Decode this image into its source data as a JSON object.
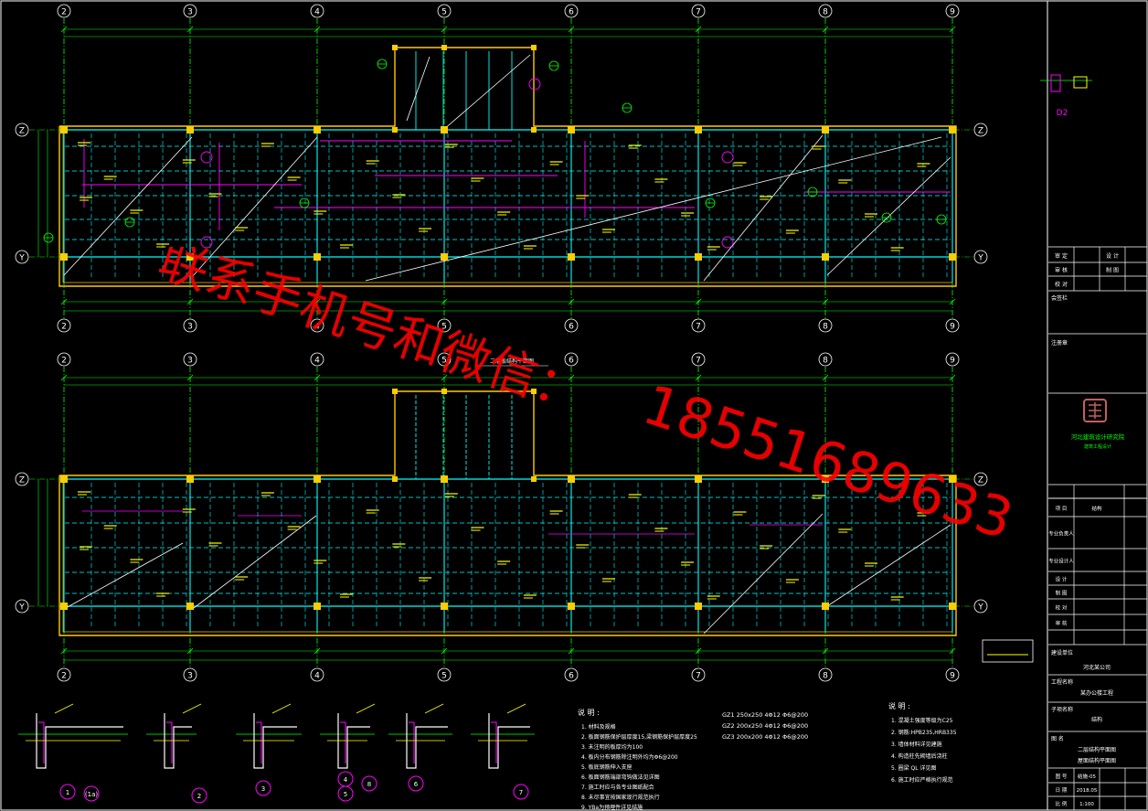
{
  "drawing": {
    "axes_x": [
      "2",
      "3",
      "4",
      "5",
      "6",
      "7",
      "8",
      "9"
    ],
    "axes_y": [
      "Z",
      "Y"
    ],
    "colors": {
      "background": "#000000",
      "wall": "#ffcc00",
      "axis": "#00ff00",
      "beam": "#00ffff",
      "slab": "#ff00ff",
      "text": "#ffff00",
      "dim": "#00ff00",
      "white": "#ffffff",
      "watermark": "#ff0000"
    }
  },
  "plans": {
    "top": {
      "label": "",
      "detail_tag": "D2"
    },
    "bottom": {
      "title": "二层板结构平面图"
    }
  },
  "details": {
    "circles": [
      "1",
      "(1a)",
      "2",
      "3",
      "4",
      "5",
      "8",
      "6",
      "7"
    ]
  },
  "notes": {
    "title_left": "说 明 :",
    "title_right": "说 明 :",
    "items_left": [
      "1. 材料及规格",
      "2. 板面钢筋保护层厚度15,梁钢筋保护层厚度25",
      "3. 未注明的板厚均为100",
      "4. 板内分布钢筋除注明外均为Φ6@200",
      "5. 板底钢筋伸入支座",
      "6. 板面钢筋端部弯钩做法见详图",
      "7. 施工时应与各专业图纸配合",
      "8. 未尽事宜按国家现行规范执行",
      "9. YBa为预埋件详见结施"
    ],
    "gz": [
      "GZ1 250x250 4Φ12 Φ6@200",
      "GZ2 200x250 4Φ12 Φ6@200",
      "GZ3 200x200 4Φ12 Φ6@200"
    ],
    "items_right": [
      "1. 混凝土强度等级为C25",
      "2. 钢筋:HPB235,HRB335",
      "3. 墙体材料详见建施",
      "4. 构造柱先砌墙后浇柱",
      "5. 圈梁 QL 详见图",
      "6. 施工时应严格执行规范"
    ]
  },
  "title_block": {
    "rows_top": [
      "审 定",
      "审 核",
      "校 对"
    ],
    "rows_top_right": [
      "设 计",
      "制 图",
      ""
    ],
    "label_notes": "会签栏",
    "label_stamp": "注册章",
    "company_name": "河北建筑设计研究院",
    "company_sub": "建筑工程设计",
    "rows_mid": [
      "项 目",
      "专业负责人",
      "专业设计人",
      "设 计",
      "制 图",
      "校 对",
      "审 核"
    ],
    "rows_mid_values": [
      "结构",
      "",
      "",
      "",
      "",
      "",
      ""
    ],
    "construction_unit": "建设单位",
    "construction_name": "河北某公司",
    "project_label": "工程名称",
    "project_name": "某办公楼工程",
    "item_label": "子项名称",
    "item_name": "结构",
    "drawing_name_label": "图  名",
    "drawing_name_1": "二层结构平面图",
    "drawing_name_2": "屋面结构平面图",
    "no_label": "图 号",
    "no_value": "结施-05",
    "date_label": "日 期",
    "date_value": "2018.05",
    "scale_label": "比 例",
    "scale_value": "1:100"
  },
  "watermark": {
    "line1": "联系手机号和微信：",
    "line2": "18551689633"
  }
}
